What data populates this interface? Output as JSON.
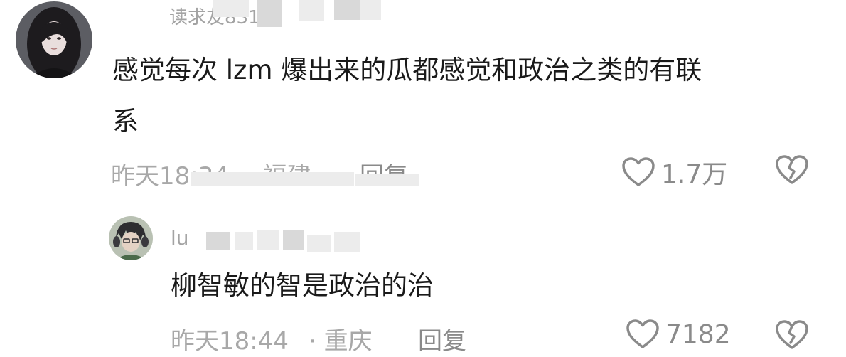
{
  "comments": [
    {
      "username": "　　　读求友83113",
      "text_line1": "感觉每次 lzm 爆出来的瓜都感觉和政治之类的有联",
      "text_line2": "系",
      "time": "昨天18:34",
      "location": "· 福建",
      "reply": "回复",
      "likes": "1.7万"
    },
    {
      "username": "lu",
      "text_line1": "柳智敏的智是政治的治",
      "time": "昨天18:44",
      "location": "· 重庆",
      "reply": "回复",
      "likes": "7182"
    }
  ],
  "icons": {
    "like": "heart-outline-icon",
    "dislike": "broken-heart-icon"
  },
  "colors": {
    "text": "#1a1a1a",
    "meta": "#a8a8a8",
    "icon": "#8a8a8a"
  }
}
